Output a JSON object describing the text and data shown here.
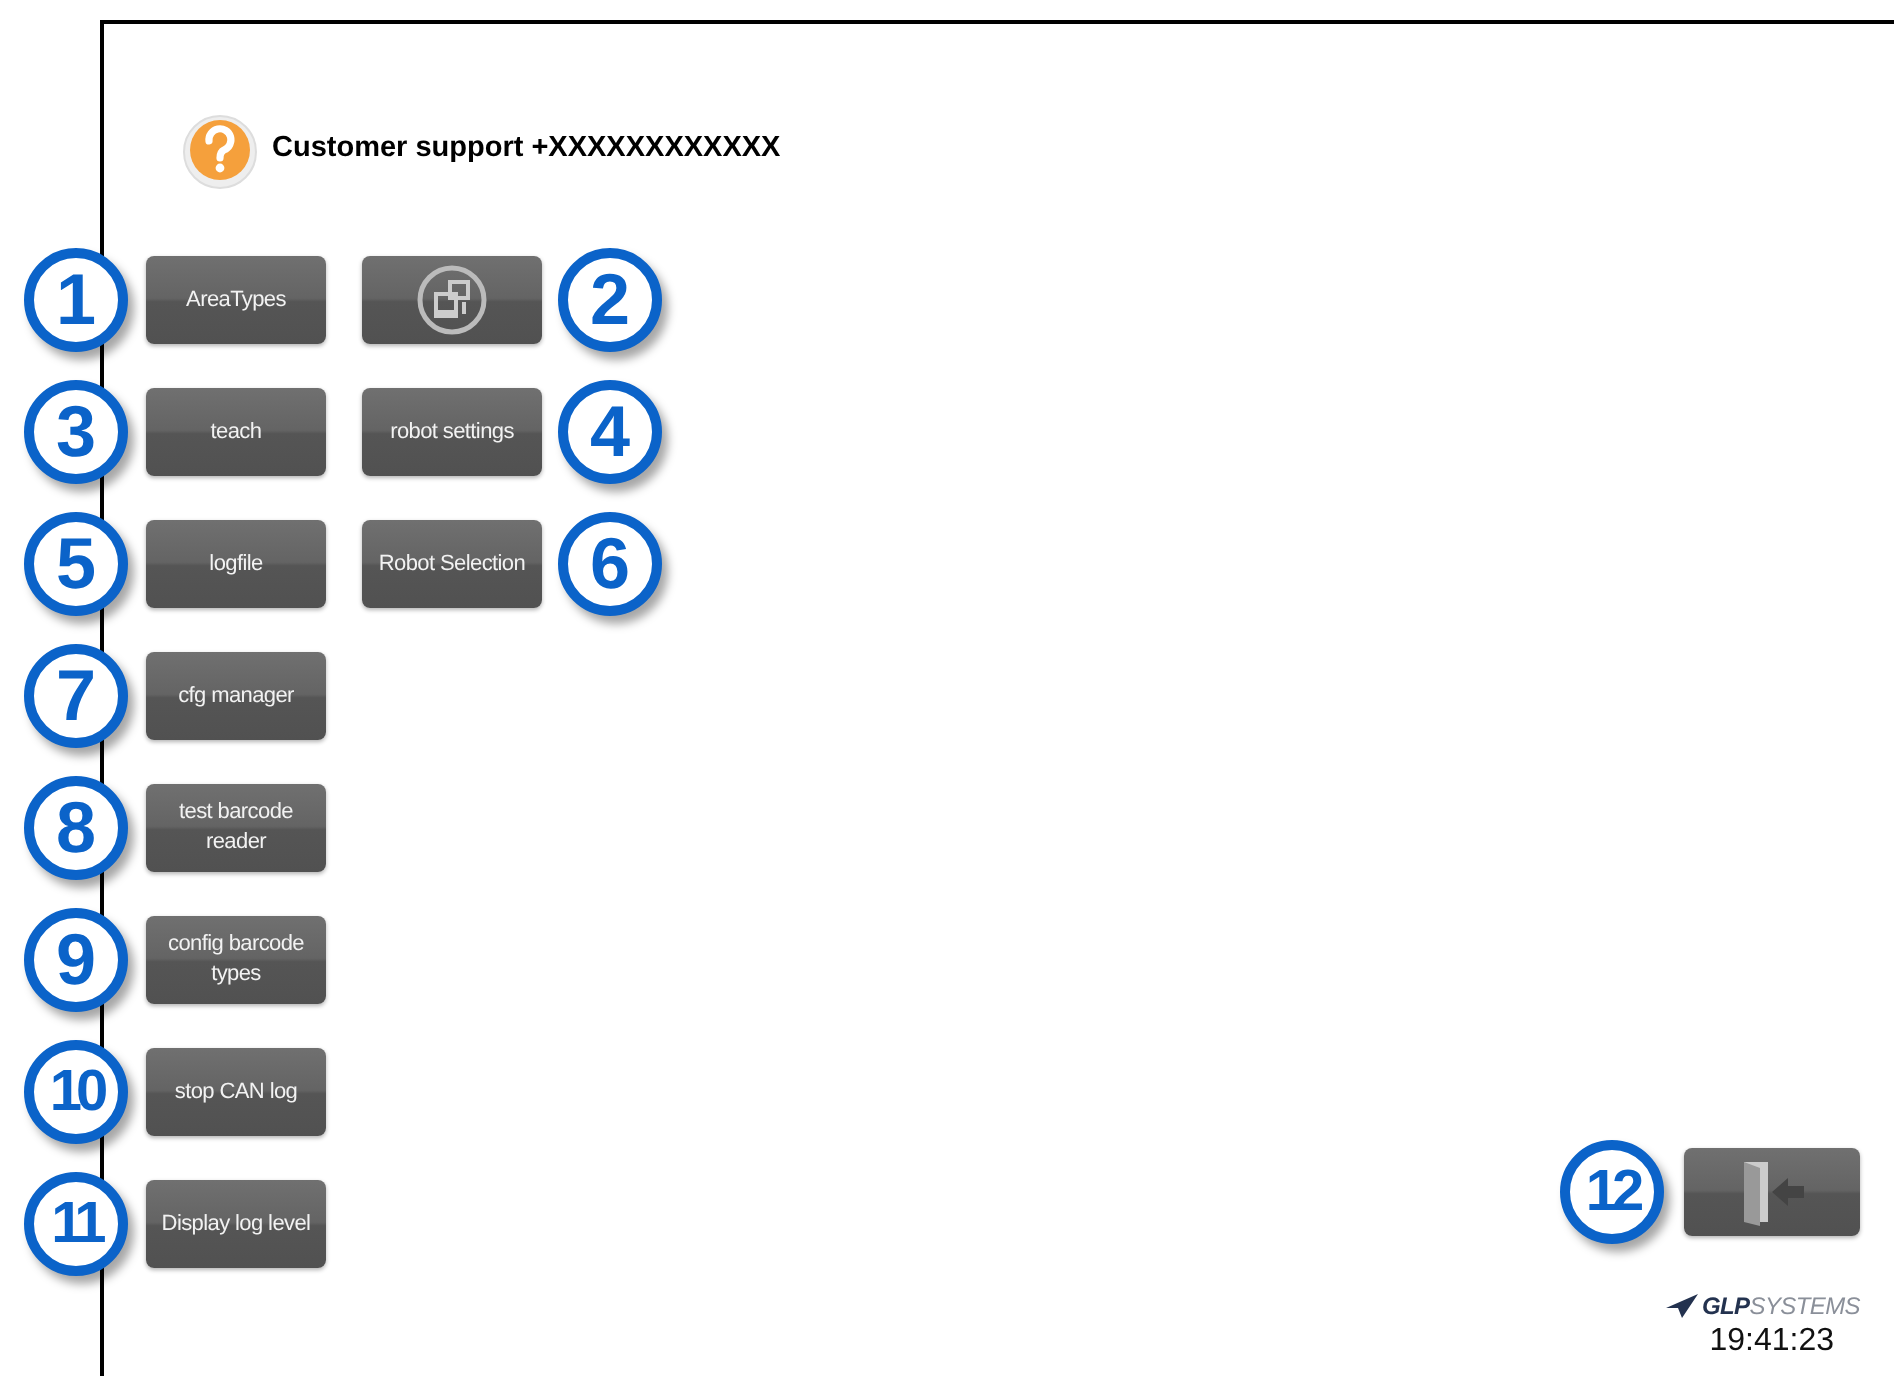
{
  "support": {
    "text": "Customer support +XXXXXXXXXXXX"
  },
  "rows": [
    {
      "left": {
        "callout": "1",
        "kind": "text",
        "label": "AreaTypes"
      },
      "right": {
        "callout": "2",
        "kind": "network"
      }
    },
    {
      "left": {
        "callout": "3",
        "kind": "text",
        "label": "teach"
      },
      "right": {
        "callout": "4",
        "kind": "text",
        "label": "robot settings"
      }
    },
    {
      "left": {
        "callout": "5",
        "kind": "text",
        "label": "logfile"
      },
      "right": {
        "callout": "6",
        "kind": "text",
        "label": "Robot Selection"
      }
    },
    {
      "left": {
        "callout": "7",
        "kind": "text",
        "label": "cfg manager"
      }
    },
    {
      "left": {
        "callout": "8",
        "kind": "text",
        "label": "test barcode reader"
      }
    },
    {
      "left": {
        "callout": "9",
        "kind": "text",
        "label": "config barcode types"
      }
    },
    {
      "left": {
        "callout": "10",
        "kind": "text",
        "label": "stop CAN log"
      }
    },
    {
      "left": {
        "callout": "11",
        "kind": "text",
        "label": "Display log level"
      }
    }
  ],
  "exit": {
    "callout": "12",
    "kind": "exit"
  },
  "logo": {
    "text": "**GLP**SYSTEMS"
  },
  "clock": "19:41:23"
}
